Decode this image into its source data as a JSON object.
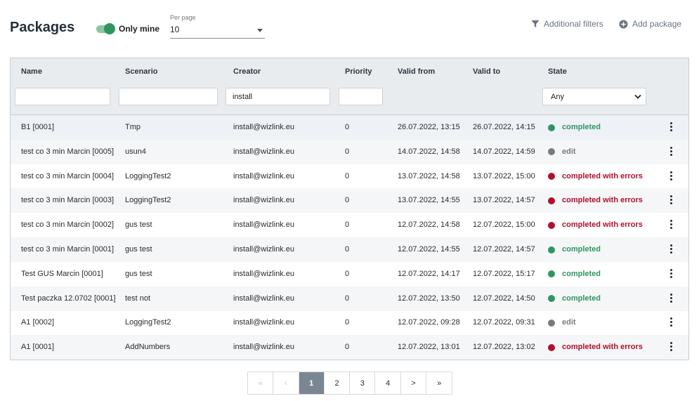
{
  "header": {
    "title": "Packages",
    "only_mine_label": "Only mine",
    "per_page_label": "Per page",
    "per_page_value": "10",
    "additional_filters_label": "Additional filters",
    "add_package_label": "Add package"
  },
  "columns": {
    "name": "Name",
    "scenario": "Scenario",
    "creator": "Creator",
    "priority": "Priority",
    "valid_from": "Valid from",
    "valid_to": "Valid to",
    "state": "State"
  },
  "filters": {
    "name": "",
    "scenario": "",
    "creator": "install",
    "priority": "",
    "state": "Any"
  },
  "colors": {
    "completed": "#2f9560",
    "edit": "#7a7a7a",
    "errors": "#b0102b",
    "accent": "#2f9560"
  },
  "rows": [
    {
      "name": "B1 [0001]",
      "scenario": "Tmp",
      "creator": "install@wizlink.eu",
      "priority": "0",
      "valid_from": "26.07.2022, 13:15",
      "valid_to": "26.07.2022, 14:15",
      "state": "completed",
      "state_kind": "completed"
    },
    {
      "name": "test co 3 min Marcin [0005]",
      "scenario": "usun4",
      "creator": "install@wizlink.eu",
      "priority": "0",
      "valid_from": "14.07.2022, 14:58",
      "valid_to": "14.07.2022, 14:59",
      "state": "edit",
      "state_kind": "edit"
    },
    {
      "name": "test co 3 min Marcin [0004]",
      "scenario": "LoggingTest2",
      "creator": "install@wizlink.eu",
      "priority": "0",
      "valid_from": "13.07.2022, 14:58",
      "valid_to": "13.07.2022, 15:00",
      "state": "completed with errors",
      "state_kind": "errors"
    },
    {
      "name": "test co 3 min Marcin [0003]",
      "scenario": "LoggingTest2",
      "creator": "install@wizlink.eu",
      "priority": "0",
      "valid_from": "13.07.2022, 14:55",
      "valid_to": "13.07.2022, 14:57",
      "state": "completed with errors",
      "state_kind": "errors"
    },
    {
      "name": "test co 3 min Marcin [0002]",
      "scenario": "gus test",
      "creator": "install@wizlink.eu",
      "priority": "0",
      "valid_from": "12.07.2022, 14:58",
      "valid_to": "12.07.2022, 15:00",
      "state": "completed with errors",
      "state_kind": "errors"
    },
    {
      "name": "test co 3 min Marcin [0001]",
      "scenario": "gus test",
      "creator": "install@wizlink.eu",
      "priority": "0",
      "valid_from": "12.07.2022, 14:55",
      "valid_to": "12.07.2022, 14:57",
      "state": "completed",
      "state_kind": "completed"
    },
    {
      "name": "Test GUS Marcin [0001]",
      "scenario": "gus test",
      "creator": "install@wizlink.eu",
      "priority": "0",
      "valid_from": "12.07.2022, 14:17",
      "valid_to": "12.07.2022, 15:17",
      "state": "completed",
      "state_kind": "completed"
    },
    {
      "name": "Test paczka 12.0702 [0001]",
      "scenario": "test not",
      "creator": "install@wizlink.eu",
      "priority": "0",
      "valid_from": "12.07.2022, 13:50",
      "valid_to": "12.07.2022, 14:50",
      "state": "completed",
      "state_kind": "completed"
    },
    {
      "name": "A1 [0002]",
      "scenario": "LoggingTest2",
      "creator": "install@wizlink.eu",
      "priority": "0",
      "valid_from": "12.07.2022, 09:28",
      "valid_to": "12.07.2022, 09:31",
      "state": "edit",
      "state_kind": "edit"
    },
    {
      "name": "A1 [0001]",
      "scenario": "AddNumbers",
      "creator": "install@wizlink.eu",
      "priority": "0",
      "valid_from": "12.07.2022, 13:01",
      "valid_to": "12.07.2022, 13:02",
      "state": "completed with errors",
      "state_kind": "errors"
    }
  ],
  "pagination": {
    "first": "«",
    "prev": "‹",
    "pages": [
      "1",
      "2",
      "3",
      "4"
    ],
    "current": "1",
    "next": ">",
    "last": "»"
  }
}
